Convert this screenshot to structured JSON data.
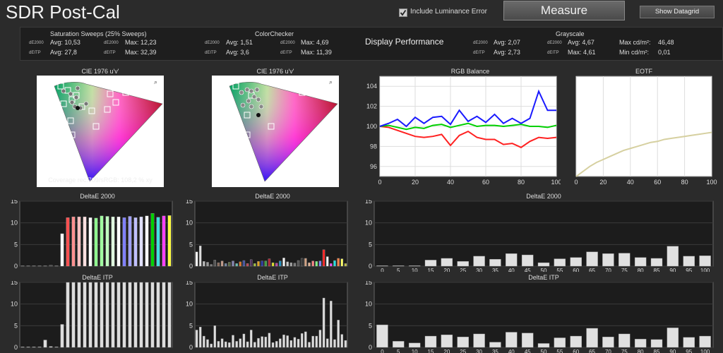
{
  "app_title": "SDR Post-Cal",
  "luminance_checkbox": {
    "label": "Include Luminance Error",
    "checked": true
  },
  "measure_button": "Measure",
  "datagrid_button": "Show Datagrid",
  "stats": {
    "saturation": {
      "title": "Saturation Sweeps (25% Sweeps)",
      "de2000_label": "dE2000",
      "deitp_label": "dEITP",
      "avg_de2000": "Avg: 10,53",
      "avg_deitp": "Avg: 27,8",
      "max_label": "dE2000",
      "max_label2": "dEITP",
      "max_de2000": "Max: 12,23",
      "max_deitp": "Max: 32,39"
    },
    "colorchecker": {
      "title": "ColorChecker",
      "de2000_label": "dE2000",
      "deitp_label": "dEITP",
      "avg_de2000": "Avg: 1,51",
      "avg_deitp": "Avg: 3,6",
      "max_label": "dE2000",
      "max_label2": "dEITP",
      "max_de2000": "Max: 4,69",
      "max_deitp": "Max: 11,39"
    },
    "display_performance": "Display Performance",
    "dp": {
      "de2000_label": "dE2000",
      "deitp_label": "dEITP",
      "avg_de2000": "Avg: 2,07",
      "avg_deitp": "Avg: 2,73"
    },
    "grayscale": {
      "title": "Grayscale",
      "de2000_label": "dE2000",
      "deitp_label": "dEITP",
      "avg_de2000": "Avg: 4,67",
      "avg_deitp": "Max: 4,61",
      "max_cd": "Max cd/m²:",
      "max_cd_val": "46,48",
      "min_cd": "Min cd/m²:",
      "min_cd_val": "0,01"
    }
  },
  "cie_left": {
    "title": "CIE 1976 u'v'",
    "coverage": "Coverage rec.709/sRGB:  108,2 % xy"
  },
  "cie_right": {
    "title": "CIE 1976 u'v'"
  },
  "chart_data": [
    {
      "type": "line",
      "title": "RGB Balance",
      "ylim": [
        95,
        105
      ],
      "xlim": [
        0,
        100
      ],
      "yticks": [
        96,
        98,
        100,
        102,
        104
      ],
      "xticks": [
        0,
        20,
        40,
        60,
        80,
        100
      ],
      "x": [
        0,
        5,
        10,
        15,
        20,
        25,
        30,
        35,
        40,
        45,
        50,
        55,
        60,
        65,
        70,
        75,
        80,
        85,
        90,
        95,
        100
      ],
      "series": [
        {
          "color": "#ff2020",
          "values": [
            100,
            99.9,
            99.6,
            99.3,
            99.0,
            98.9,
            99.0,
            99.2,
            98.1,
            99.1,
            99.5,
            98.9,
            98.7,
            98.7,
            98.2,
            98.3,
            97.9,
            98.5,
            98.9,
            98.8,
            98.9
          ]
        },
        {
          "color": "#00d000",
          "values": [
            100,
            100.1,
            99.9,
            99.7,
            99.9,
            99.8,
            100.1,
            100.2,
            99.9,
            100.1,
            100.3,
            100.0,
            100.1,
            100.1,
            100.0,
            100.1,
            100.2,
            100.0,
            100.0,
            99.9,
            100.1
          ]
        },
        {
          "color": "#1a1aff",
          "values": [
            100,
            100.3,
            100.7,
            100.0,
            100.9,
            100.3,
            100.9,
            101.0,
            100.2,
            101.6,
            100.5,
            101.0,
            100.4,
            101.2,
            100.3,
            100.8,
            100.3,
            100.8,
            103.5,
            101.6,
            101.6
          ]
        }
      ]
    },
    {
      "type": "line",
      "title": "EOTF",
      "ylim": [
        0,
        1
      ],
      "xlim": [
        0,
        100
      ],
      "xticks": [
        0,
        20,
        40,
        60,
        80,
        100
      ],
      "yticks": [],
      "x": [
        0,
        5,
        10,
        15,
        20,
        25,
        30,
        35,
        40,
        45,
        50,
        55,
        60,
        65,
        70,
        75,
        80,
        85,
        90,
        95,
        100
      ],
      "series": [
        {
          "color": "#d6d0a0",
          "values": [
            0.0,
            0.05,
            0.1,
            0.14,
            0.17,
            0.2,
            0.23,
            0.26,
            0.28,
            0.3,
            0.32,
            0.34,
            0.35,
            0.37,
            0.38,
            0.39,
            0.4,
            0.41,
            0.42,
            0.43,
            0.44
          ]
        }
      ]
    },
    {
      "type": "bar",
      "title": "DeltaE 2000",
      "ylim": [
        0,
        15
      ],
      "yticks": [
        0,
        5,
        10,
        15
      ],
      "panel": "saturation",
      "values": [
        0.1,
        0.1,
        0.1,
        0.1,
        0.1,
        0.2,
        0.1,
        7.5,
        11.2,
        11.4,
        11.4,
        11.4,
        11.2,
        11.1,
        11.6,
        11.5,
        11.4,
        11.4,
        11.2,
        11.5,
        11.2,
        11.4,
        11.6,
        12.2,
        11.3,
        11.6,
        11.7
      ],
      "colors": [
        "#444",
        "#444",
        "#444",
        "#444",
        "#444",
        "#444",
        "#444",
        "#fff",
        "#ff5050",
        "#ff9090",
        "#ffc0c0",
        "#ffe0e0",
        "#ffffff",
        "#90ff90",
        "#a0ffa0",
        "#c0ffc0",
        "#e0ffe0",
        "#ffffff",
        "#8080ff",
        "#a0a0ff",
        "#c0c0ff",
        "#e0e0ff",
        "#ffffff",
        "#00d000",
        "#40e0e0",
        "#ff40ff",
        "#ffff40"
      ]
    },
    {
      "type": "bar",
      "title": "DeltaE 2000",
      "ylim": [
        0,
        15
      ],
      "yticks": [
        0,
        5,
        10,
        15
      ],
      "panel": "colorchecker",
      "values": [
        3.3,
        4.7,
        1.1,
        0.9,
        0.4,
        1.4,
        0.8,
        1.2,
        0.6,
        0.9,
        1.2,
        0.6,
        1.0,
        1.3,
        0.6,
        1.5,
        0.6,
        1.1,
        1.2,
        1.2,
        1.7,
        0.8,
        0.7,
        1.2,
        1.9,
        1.0,
        0.8,
        0.7,
        1.3,
        1.8,
        1.8,
        0.8,
        1.2,
        1.1,
        1.2,
        3.8,
        2.2,
        0.6,
        1.3,
        1.8,
        1.7,
        0.6
      ],
      "colors": [
        "#ffffff",
        "#dddddd",
        "#bbbbbb",
        "#999999",
        "#777777",
        "#555555",
        "#8a6a5a",
        "#c49a88",
        "#6a80a0",
        "#5a6a40",
        "#8080b0",
        "#60c0b0",
        "#e07020",
        "#4050a0",
        "#c04050",
        "#503060",
        "#a0c030",
        "#e0a020",
        "#2030a0",
        "#40a040",
        "#b02030",
        "#e0e020",
        "#c040a0",
        "#2090c0",
        "#f5f5f5",
        "#c8c8c8",
        "#a0a0a0",
        "#7a7a7a",
        "#555555",
        "#333333",
        "#d0a080",
        "#e0b090",
        "#ff8080",
        "#80ff80",
        "#8080ff",
        "#ff2020",
        "#ffffff",
        "#ff40ff",
        "#20e0e0",
        "#ff8040",
        "#ffff60",
        "#c0c040"
      ]
    },
    {
      "type": "bar",
      "title": "DeltaE 2000",
      "ylim": [
        0,
        15
      ],
      "yticks": [
        0,
        5,
        10,
        15
      ],
      "panel": "grayscale",
      "categories": [
        "0",
        "5",
        "10",
        "15",
        "20",
        "25",
        "30",
        "35",
        "40",
        "45",
        "50",
        "55",
        "60",
        "65",
        "70",
        "75",
        "80",
        "85",
        "90",
        "95",
        "100"
      ],
      "values": [
        0.1,
        0.1,
        0.1,
        1.4,
        1.8,
        1.1,
        2.3,
        1.6,
        2.9,
        2.6,
        0.8,
        1.7,
        2.0,
        3.3,
        2.9,
        3.0,
        2.0,
        1.8,
        4.6,
        2.3,
        2.4
      ]
    },
    {
      "type": "bar",
      "title": "DeltaE ITP",
      "ylim": [
        0,
        15
      ],
      "yticks": [
        0,
        5,
        10,
        15
      ],
      "panel": "saturation",
      "values": [
        0.1,
        0.1,
        0.1,
        0.1,
        1.7,
        0.2,
        0.1,
        5.3,
        28,
        28,
        28,
        28,
        28,
        28,
        28,
        28,
        28,
        28,
        28,
        28,
        28,
        28,
        28,
        28,
        28,
        28,
        28
      ]
    },
    {
      "type": "bar",
      "title": "DeltaE ITP",
      "ylim": [
        0,
        15
      ],
      "yticks": [
        0,
        5,
        10,
        15
      ],
      "panel": "colorchecker",
      "values": [
        4.0,
        4.7,
        2.6,
        1.8,
        0.8,
        5.0,
        1.4,
        2.0,
        1.3,
        1.1,
        2.8,
        1.4,
        2.0,
        3.1,
        1.3,
        4.0,
        1.2,
        2.1,
        2.5,
        2.4,
        3.3,
        1.1,
        1.4,
        2.0,
        2.9,
        2.7,
        1.6,
        2.3,
        1.9,
        3.2,
        3.6,
        1.2,
        2.6,
        2.6,
        4.0,
        11.4,
        2.0,
        10.7,
        1.8,
        6.3,
        3.0,
        1.6
      ]
    },
    {
      "type": "bar",
      "title": "DeltaE ITP",
      "ylim": [
        0,
        15
      ],
      "yticks": [
        0,
        5,
        10,
        15
      ],
      "panel": "grayscale",
      "categories": [
        "0",
        "5",
        "10",
        "15",
        "20",
        "25",
        "30",
        "35",
        "40",
        "45",
        "50",
        "55",
        "60",
        "65",
        "70",
        "75",
        "80",
        "85",
        "90",
        "95",
        "100"
      ],
      "values": [
        5.2,
        1.4,
        1.0,
        2.6,
        2.9,
        2.4,
        3.1,
        1.2,
        3.5,
        3.3,
        0.9,
        2.2,
        2.6,
        4.4,
        2.4,
        3.1,
        1.9,
        1.8,
        4.5,
        2.3,
        2.6
      ]
    }
  ]
}
